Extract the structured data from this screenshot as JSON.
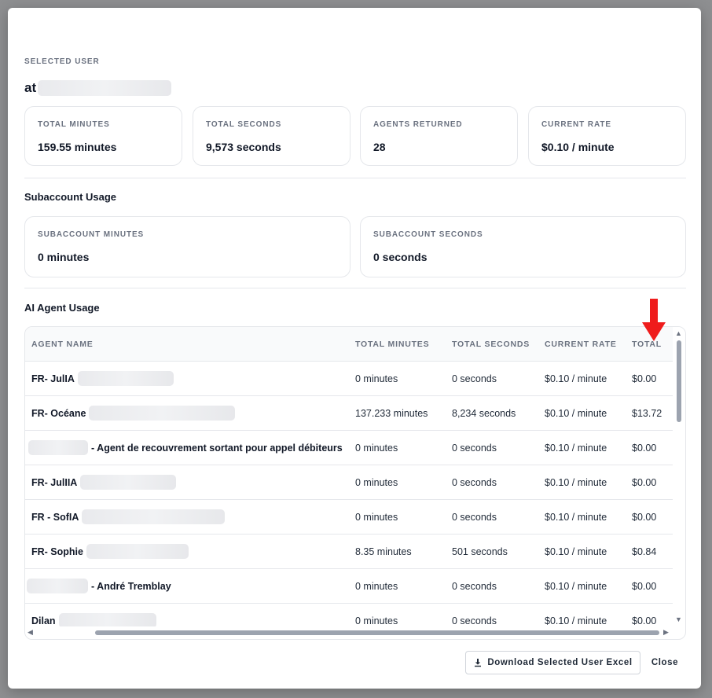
{
  "selected_user": {
    "label": "SELECTED USER",
    "name_prefix": "at"
  },
  "stats": [
    {
      "label": "TOTAL MINUTES",
      "value": "159.55 minutes"
    },
    {
      "label": "TOTAL SECONDS",
      "value": "9,573 seconds"
    },
    {
      "label": "AGENTS RETURNED",
      "value": "28"
    },
    {
      "label": "CURRENT RATE",
      "value": "$0.10 / minute"
    }
  ],
  "subaccount": {
    "title": "Subaccount Usage",
    "cards": [
      {
        "label": "SUBACCOUNT MINUTES",
        "value": "0 minutes"
      },
      {
        "label": "SUBACCOUNT SECONDS",
        "value": "0 seconds"
      }
    ]
  },
  "agent_usage": {
    "title": "AI Agent Usage",
    "columns": [
      "AGENT NAME",
      "TOTAL MINUTES",
      "TOTAL SECONDS",
      "CURRENT RATE",
      "TOTAL"
    ],
    "rows": [
      {
        "name": "FR- JulIA",
        "minutes": "0 minutes",
        "seconds": "0 seconds",
        "rate": "$0.10 / minute",
        "total": "$0.00"
      },
      {
        "name": "FR- Océane",
        "minutes": "137.233 minutes",
        "seconds": "8,234 seconds",
        "rate": "$0.10 / minute",
        "total": "$13.72"
      },
      {
        "name": "- Agent de recouvrement sortant pour appel débiteurs",
        "minutes": "0 minutes",
        "seconds": "0 seconds",
        "rate": "$0.10 / minute",
        "total": "$0.00"
      },
      {
        "name": "FR- JulIIA",
        "minutes": "0 minutes",
        "seconds": "0 seconds",
        "rate": "$0.10 / minute",
        "total": "$0.00"
      },
      {
        "name": "FR - SofIA",
        "minutes": "0 minutes",
        "seconds": "0 seconds",
        "rate": "$0.10 / minute",
        "total": "$0.00"
      },
      {
        "name": "FR- Sophie",
        "minutes": "8.35 minutes",
        "seconds": "501 seconds",
        "rate": "$0.10 / minute",
        "total": "$0.84"
      },
      {
        "name": "- André Tremblay",
        "minutes": "0 minutes",
        "seconds": "0 seconds",
        "rate": "$0.10 / minute",
        "total": "$0.00"
      },
      {
        "name": "Dilan",
        "minutes": "0 minutes",
        "seconds": "0 seconds",
        "rate": "$0.10 / minute",
        "total": "$0.00"
      }
    ]
  },
  "footer": {
    "download_label": "Download Selected User Excel",
    "close_label": "Close"
  },
  "colors": {
    "annotation_arrow": "#ef1c1c",
    "border": "#e5e7eb",
    "muted_text": "#6b7280"
  },
  "icons": {
    "download": "download-icon",
    "annotation": "red-down-arrow"
  }
}
